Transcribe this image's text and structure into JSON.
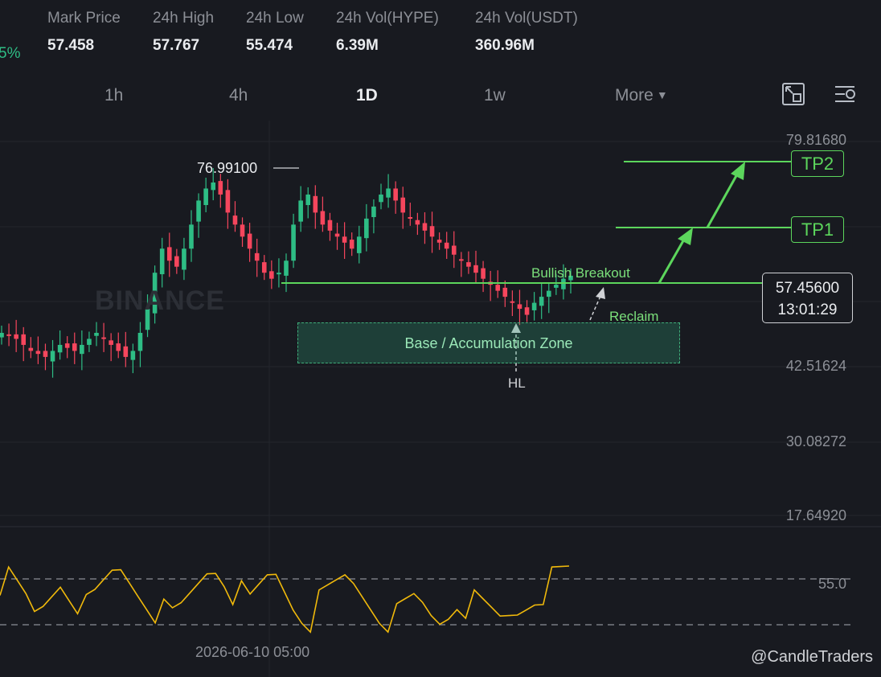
{
  "stats": {
    "change_pct": "5%",
    "items": [
      {
        "label": "Mark Price",
        "value": "57.458"
      },
      {
        "label": "24h High",
        "value": "57.767"
      },
      {
        "label": "24h Low",
        "value": "55.474"
      },
      {
        "label": "24h Vol(HYPE)",
        "value": "6.39M"
      },
      {
        "label": "24h Vol(USDT)",
        "value": "360.96M"
      }
    ]
  },
  "timeframes": {
    "tabs": [
      {
        "label": "1h"
      },
      {
        "label": "4h"
      },
      {
        "label": "1D",
        "active": true
      },
      {
        "label": "1w"
      }
    ],
    "more_label": "More",
    "icons": [
      "chart-layout-icon",
      "indicator-settings-icon"
    ]
  },
  "chart": {
    "watermark": "BINANCE",
    "y_labels": [
      "79.81680",
      "42.51624",
      "30.08272",
      "17.64920"
    ],
    "peak_label": "76.99100",
    "current_price": "57.45600",
    "countdown": "13:01:29",
    "annotations": {
      "tp2": "TP2",
      "tp1": "TP1",
      "breakout": "Bullish Breakout",
      "reclaim": "Reclaim",
      "zone": "Base / Accumulation Zone",
      "hl": "HL"
    },
    "date_label": "2026-06-10 05:00",
    "rsi_level_label": "55.0",
    "credit": "@CandleTraders",
    "colors": {
      "up": "#2ebd85",
      "down": "#f6465d",
      "annotation": "#5cd65c",
      "rsi": "#f0b90b"
    }
  },
  "chart_data": {
    "type": "candlestick",
    "y_ticks": [
      79.8168,
      42.51624,
      30.08272,
      17.6492
    ],
    "ylim": [
      10,
      85
    ],
    "levels": {
      "current": 57.456,
      "tp1": 66.5,
      "tp2": 75.2
    },
    "close_path": [
      48,
      47.5,
      47,
      46,
      45,
      44.5,
      44,
      45,
      46,
      45.5,
      45,
      46,
      47,
      48,
      47,
      46,
      45,
      44,
      45,
      48,
      52,
      58,
      62,
      60,
      59,
      62,
      66,
      70,
      72,
      73,
      71,
      68,
      66,
      64,
      62,
      60,
      58,
      57,
      58,
      60,
      66,
      70,
      71,
      68,
      66,
      65,
      64,
      63,
      62,
      64,
      67,
      69,
      71,
      72,
      70,
      68,
      67,
      66,
      65,
      64,
      63,
      62,
      61,
      60,
      59,
      58,
      57,
      56,
      55,
      54,
      53,
      52,
      51,
      53,
      54,
      55,
      56,
      57,
      57.5
    ],
    "rsi": {
      "levels": [
        55,
        45
      ],
      "values": [
        55,
        54,
        52,
        50,
        47,
        49,
        52,
        55,
        53,
        51,
        48,
        50,
        53,
        56,
        57,
        55,
        53,
        51,
        49,
        47,
        46,
        48,
        51,
        54,
        57,
        58,
        56,
        53,
        51,
        49,
        52,
        55,
        56,
        53,
        50,
        48,
        47,
        49,
        51,
        53,
        55,
        54,
        52,
        50,
        48,
        47,
        46,
        48,
        50,
        49,
        47,
        46,
        48,
        51,
        50,
        49,
        48,
        47,
        46,
        47,
        48,
        50,
        52,
        53,
        54,
        55,
        56
      ]
    }
  }
}
